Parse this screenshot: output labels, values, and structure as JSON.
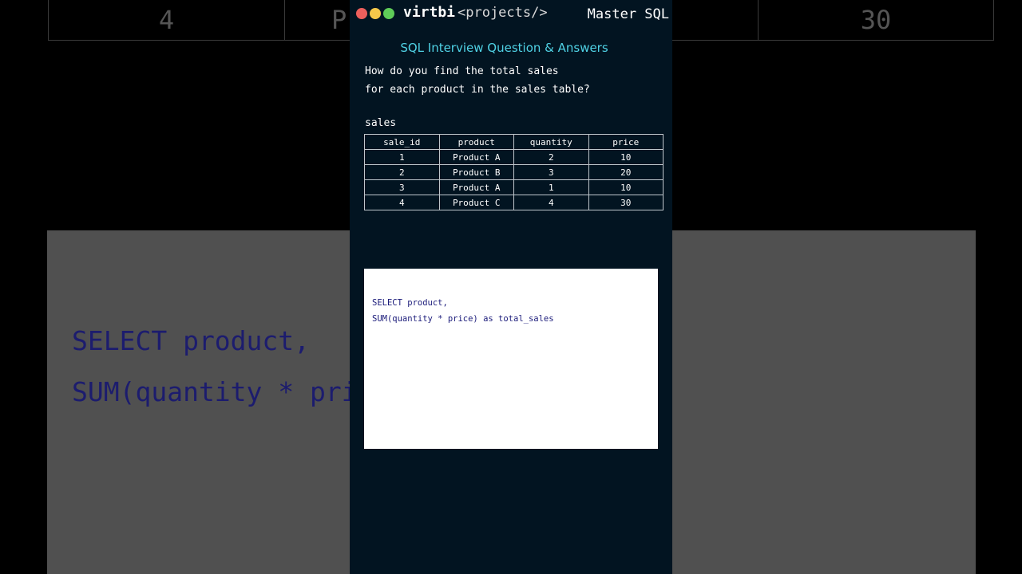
{
  "header": {
    "brand": "virtbi",
    "brand_suffix": "<projects/>",
    "badge": "Master SQL",
    "window_dots": [
      "#ed5f5c",
      "#f5c84a",
      "#5fcc58"
    ]
  },
  "title": "SQL Interview Question & Answers",
  "question": {
    "line1": "How do you find the total sales",
    "line2": "for each product in the sales table?"
  },
  "table": {
    "name": "sales",
    "columns": [
      "sale_id",
      "product",
      "quantity",
      "price"
    ],
    "rows": [
      [
        "1",
        "Product A",
        "2",
        "10"
      ],
      [
        "2",
        "Product B",
        "3",
        "20"
      ],
      [
        "3",
        "Product A",
        "1",
        "10"
      ],
      [
        "4",
        "Product C",
        "4",
        "30"
      ]
    ]
  },
  "code": {
    "line1": "SELECT product,",
    "line2": "SUM(quantity * price) as total_sales"
  },
  "background": {
    "row_cells": [
      "4",
      "P",
      "30"
    ],
    "code_line1": "SELECT product,",
    "code_line2": "SUM(quantity * pri"
  },
  "colors": {
    "panel_bg": "#021421",
    "heading": "#4fd1e4",
    "code_text": "#1b1b7a"
  }
}
